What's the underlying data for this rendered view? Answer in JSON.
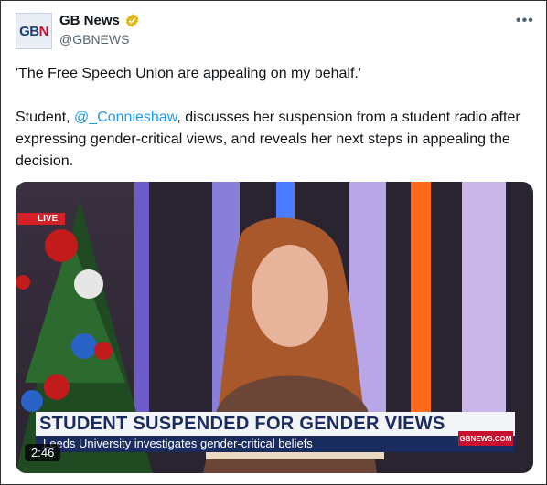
{
  "tweet": {
    "author_name": "GB News",
    "author_handle": "@GBNEWS",
    "avatar_text_a": "GB",
    "avatar_text_b": "N",
    "more_label": "•••",
    "paragraph1": "'The Free Speech Union are appealing on my behalf.'",
    "paragraph2_prefix": "Student, ",
    "mention": "@_Connieshaw",
    "paragraph2_suffix": ", discusses her suspension from a student radio after expressing gender-critical views, and reveals her next steps in appealing the decision."
  },
  "video": {
    "live_badge": "LIVE",
    "headline": "STUDENT SUSPENDED FOR GENDER VIEWS",
    "subline": "Leeds University investigates gender-critical beliefs",
    "channel_url": "GBNEWS.COM",
    "duration": "2:46"
  },
  "colors": {
    "accent": "#1d9bf0",
    "verified": "#e2b719",
    "brand_red": "#c8102e",
    "brand_navy": "#1a2b5e"
  }
}
